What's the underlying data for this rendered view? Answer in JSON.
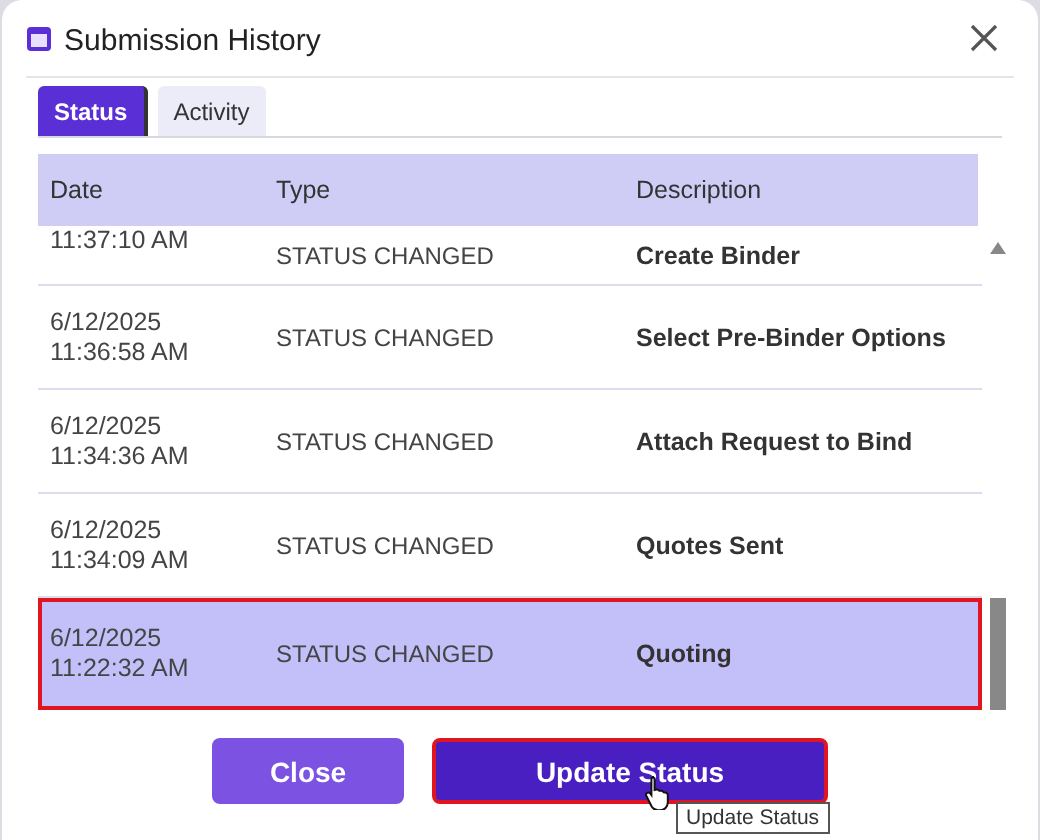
{
  "window": {
    "title": "Submission History"
  },
  "tabs": [
    {
      "label": "Status",
      "selected": true
    },
    {
      "label": "Activity",
      "selected": false
    }
  ],
  "table": {
    "columns": [
      "Date",
      "Type",
      "Description"
    ],
    "rows": [
      {
        "time": "11:37:10 AM",
        "type": "STATUS CHANGED",
        "description": "Create Binder",
        "selected": false
      },
      {
        "date": "6/12/2025",
        "time": "11:36:58 AM",
        "type": "STATUS CHANGED",
        "description": "Select Pre-Binder Options",
        "selected": false
      },
      {
        "date": "6/12/2025",
        "time": "11:34:36 AM",
        "type": "STATUS CHANGED",
        "description": "Attach Request to Bind",
        "selected": false
      },
      {
        "date": "6/12/2025",
        "time": "11:34:09 AM",
        "type": "STATUS CHANGED",
        "description": "Quotes Sent",
        "selected": false
      },
      {
        "date": "6/12/2025",
        "time": "11:22:32 AM",
        "type": "STATUS CHANGED",
        "description": "Quoting",
        "selected": true
      }
    ]
  },
  "buttons": [
    {
      "label": "Close",
      "kind": "secondary",
      "highlighted": false
    },
    {
      "label": "Update Status",
      "kind": "primary",
      "highlighted": true,
      "tooltip": "Update Status"
    }
  ]
}
